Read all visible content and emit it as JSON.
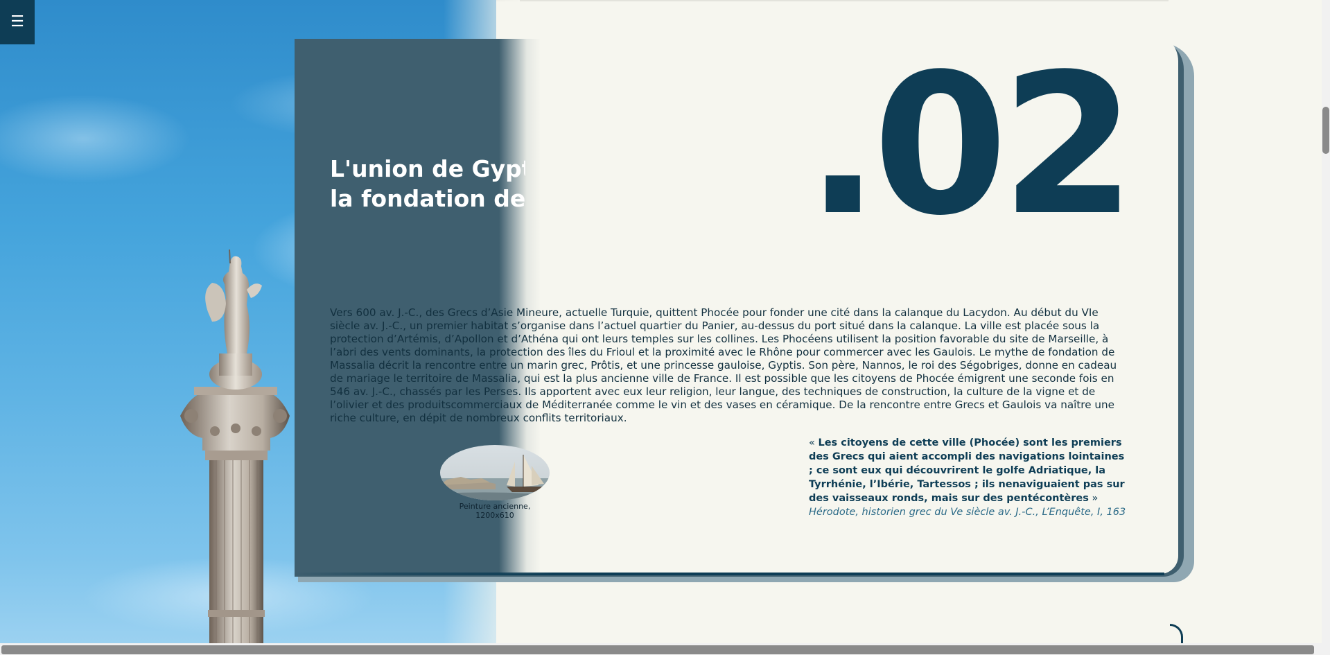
{
  "menu": {
    "icon_glyph": "☰",
    "icon": "hamburger-menu-icon"
  },
  "section": {
    "number": ".02",
    "title_line1": "L'union de Gyptis et Protis,",
    "title_line2": "la fondation de Marseille",
    "body": "Vers 600 av. J.-C., des Grecs d’Asie Mineure, actuelle Turquie, quittent Phocée pour fonder une cité dans la calanque du Lacydon. Au début du VIe siècle av. J.-C., un premier habitat s’organise dans l’actuel quartier du Panier, au-dessus du port situé dans la calanque. La ville est placée sous la protection d’Artémis, d’Apollon et d’Athéna qui ont leurs temples sur les collines. Les Phocéens utilisent la position favorable du site de Marseille, à l’abri des vents dominants, la protection des îles du Frioul et la proximité avec le Rhône pour commercer avec les Gaulois. Le mythe de fondation de Massalia décrit la rencontre entre un marin grec, Prôtis, et une princesse gauloise, Gyptis. Son père, Nannos, le roi des Ségobriges, donne en cadeau de mariage le territoire de Massalia, qui est la plus ancienne ville de France. Il est possible que les citoyens de Phocée émigrent une seconde fois en 546 av. J.-C., chassés par les Perses. Ils apportent avec eux leur religion, leur langue, des techniques de construction, la culture de la vigne et de l’olivier et des produitscommerciaux de Méditerranée comme le vin et des vases en céramique. De la rencontre entre Grecs et Gaulois va naître une riche culture, en dépit de nombreux conflits territoriaux.",
    "figure_caption": "Peinture ancienne, 1200x610",
    "quote_open": "« ",
    "quote_text": "Les citoyens de cette ville (Phocée) sont les premiers des Grecs qui aient accompli des navigations lointaines ; ce sont eux qui découvrirent le golfe Adriatique, la Tyrrhénie, l’Ibérie, Tartessos ; ils nenaviguaient pas sur des vaisseaux ronds, mais sur des pentécontères",
    "quote_close": " » ",
    "quote_source": "Hérodote, historien grec du Ve siècle av. J.-C., L’Enquête, I, 163"
  },
  "colors": {
    "navy": "#0e3d55",
    "cream": "#f6f6ef",
    "sky": "#45a4dc",
    "source_text": "#2b6a87"
  }
}
